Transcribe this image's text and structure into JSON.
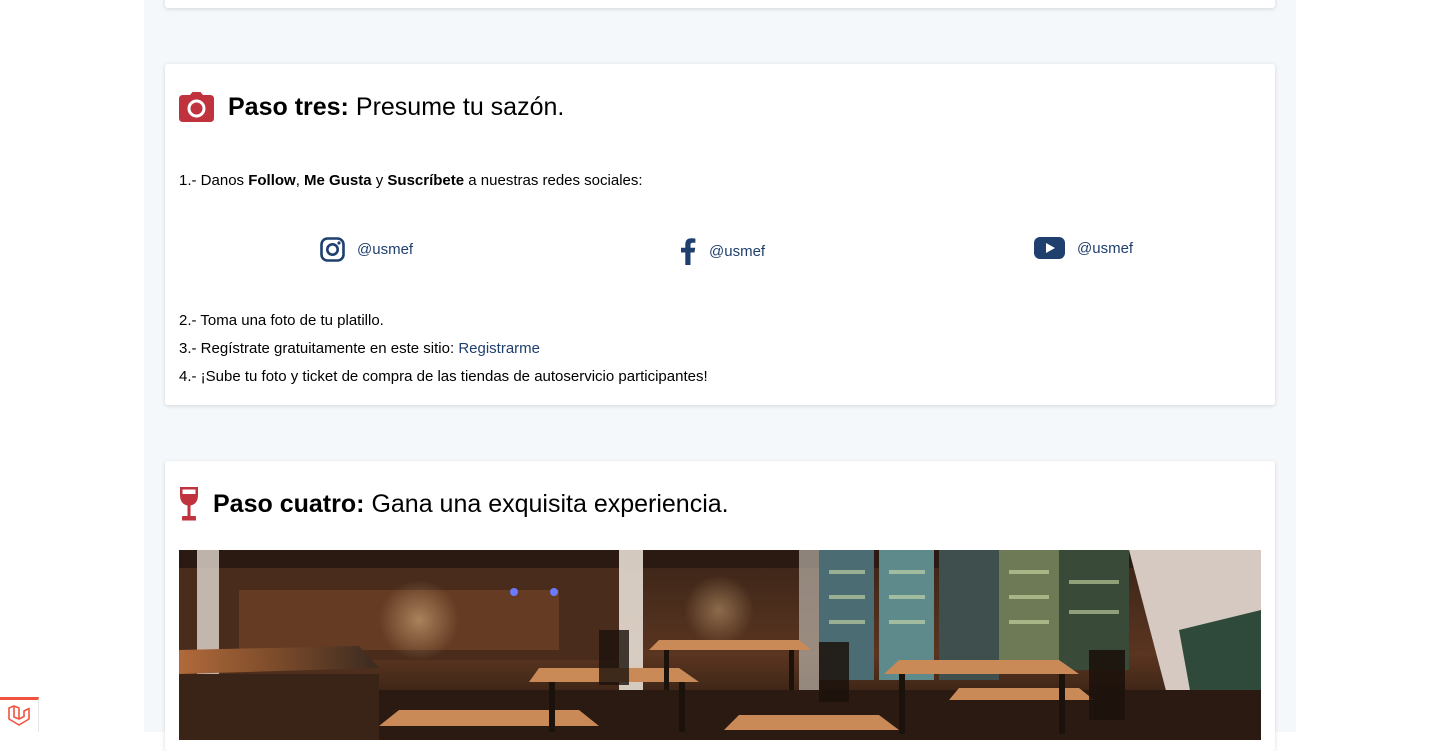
{
  "step_three": {
    "title_lead": "Paso tres:",
    "title_rest": "Presume tu sazón.",
    "icon": "camera-icon",
    "item1": {
      "prefix": "1.- Danos ",
      "follow": "Follow",
      "comma": ", ",
      "like": "Me Gusta",
      "and": " y ",
      "subscribe": "Suscríbete",
      "suffix": " a nuestras redes sociales:"
    },
    "socials": [
      {
        "icon": "instagram-icon",
        "handle": "@usmef"
      },
      {
        "icon": "facebook-icon",
        "handle": "@usmef"
      },
      {
        "icon": "youtube-icon",
        "handle": "@usmef"
      }
    ],
    "item2": "2.- Toma una foto de tu platillo.",
    "item3_text": "3.- Regístrate gratuitamente en este sitio: ",
    "item3_link": "Registrarme",
    "item4": "4.- ¡Sube tu foto y ticket de compra de las tiendas de autoservicio participantes!"
  },
  "step_four": {
    "title_lead": "Paso cuatro:",
    "title_rest": "Gana una exquisita experiencia.",
    "icon": "wine-glass-icon",
    "image": "restaurant-interior-photo"
  },
  "colors": {
    "accent_red": "#c0323d",
    "link_blue": "#1f3f6f",
    "page_bg": "#f5f8fb",
    "laravel_red": "#f05340"
  },
  "footer_badge": {
    "icon": "laravel-icon"
  }
}
